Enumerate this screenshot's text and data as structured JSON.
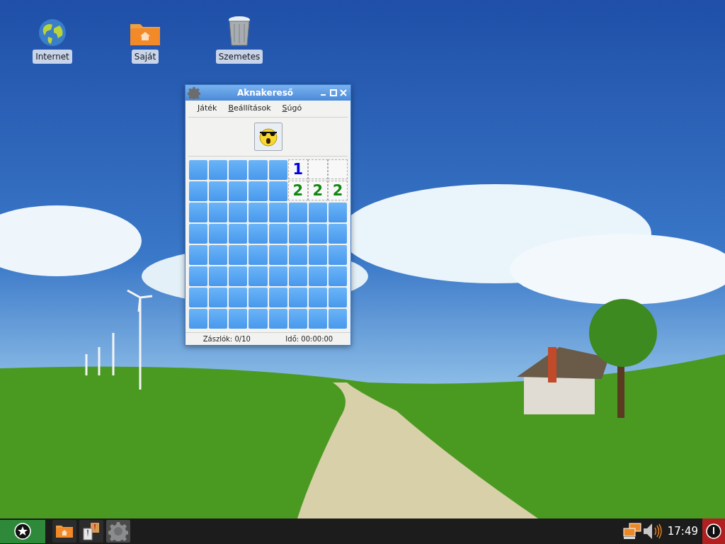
{
  "desktop_icons": [
    {
      "label": "Internet",
      "kind": "globe"
    },
    {
      "label": "Saját",
      "kind": "folder"
    },
    {
      "label": "Szemetes",
      "kind": "trash"
    }
  ],
  "window": {
    "title": "Aknakereső",
    "menu": [
      {
        "label": "Játék"
      },
      {
        "label": "Beállítások"
      },
      {
        "label": "Súgó"
      }
    ],
    "grid": [
      [
        {
          "open": false
        },
        {
          "open": false
        },
        {
          "open": false
        },
        {
          "open": false
        },
        {
          "open": false
        },
        {
          "open": true,
          "text": "1",
          "color": "#0000dd"
        },
        {
          "open": true
        },
        {
          "open": true
        }
      ],
      [
        {
          "open": false
        },
        {
          "open": false
        },
        {
          "open": false
        },
        {
          "open": false
        },
        {
          "open": false
        },
        {
          "open": true,
          "text": "2",
          "color": "#118811"
        },
        {
          "open": true,
          "text": "2",
          "color": "#118811"
        },
        {
          "open": true,
          "text": "2",
          "color": "#118811"
        }
      ],
      [
        {
          "open": false
        },
        {
          "open": false
        },
        {
          "open": false
        },
        {
          "open": false
        },
        {
          "open": false
        },
        {
          "open": false
        },
        {
          "open": false
        },
        {
          "open": false
        }
      ],
      [
        {
          "open": false
        },
        {
          "open": false
        },
        {
          "open": false
        },
        {
          "open": false
        },
        {
          "open": false
        },
        {
          "open": false
        },
        {
          "open": false
        },
        {
          "open": false
        }
      ],
      [
        {
          "open": false
        },
        {
          "open": false
        },
        {
          "open": false
        },
        {
          "open": false
        },
        {
          "open": false
        },
        {
          "open": false
        },
        {
          "open": false
        },
        {
          "open": false
        }
      ],
      [
        {
          "open": false
        },
        {
          "open": false
        },
        {
          "open": false
        },
        {
          "open": false
        },
        {
          "open": false
        },
        {
          "open": false
        },
        {
          "open": false
        },
        {
          "open": false
        }
      ],
      [
        {
          "open": false
        },
        {
          "open": false
        },
        {
          "open": false
        },
        {
          "open": false
        },
        {
          "open": false
        },
        {
          "open": false
        },
        {
          "open": false
        },
        {
          "open": false
        }
      ],
      [
        {
          "open": false
        },
        {
          "open": false
        },
        {
          "open": false
        },
        {
          "open": false
        },
        {
          "open": false
        },
        {
          "open": false
        },
        {
          "open": false
        },
        {
          "open": false
        }
      ]
    ],
    "status": {
      "flags": "Zászlók: 0/10",
      "time": "Idő: 00:00:00"
    }
  },
  "taskbar": {
    "tasks": [
      {
        "kind": "folder",
        "selected": false
      },
      {
        "kind": "shirts",
        "selected": false
      },
      {
        "kind": "gear",
        "selected": true
      }
    ],
    "clock": "17:49"
  }
}
